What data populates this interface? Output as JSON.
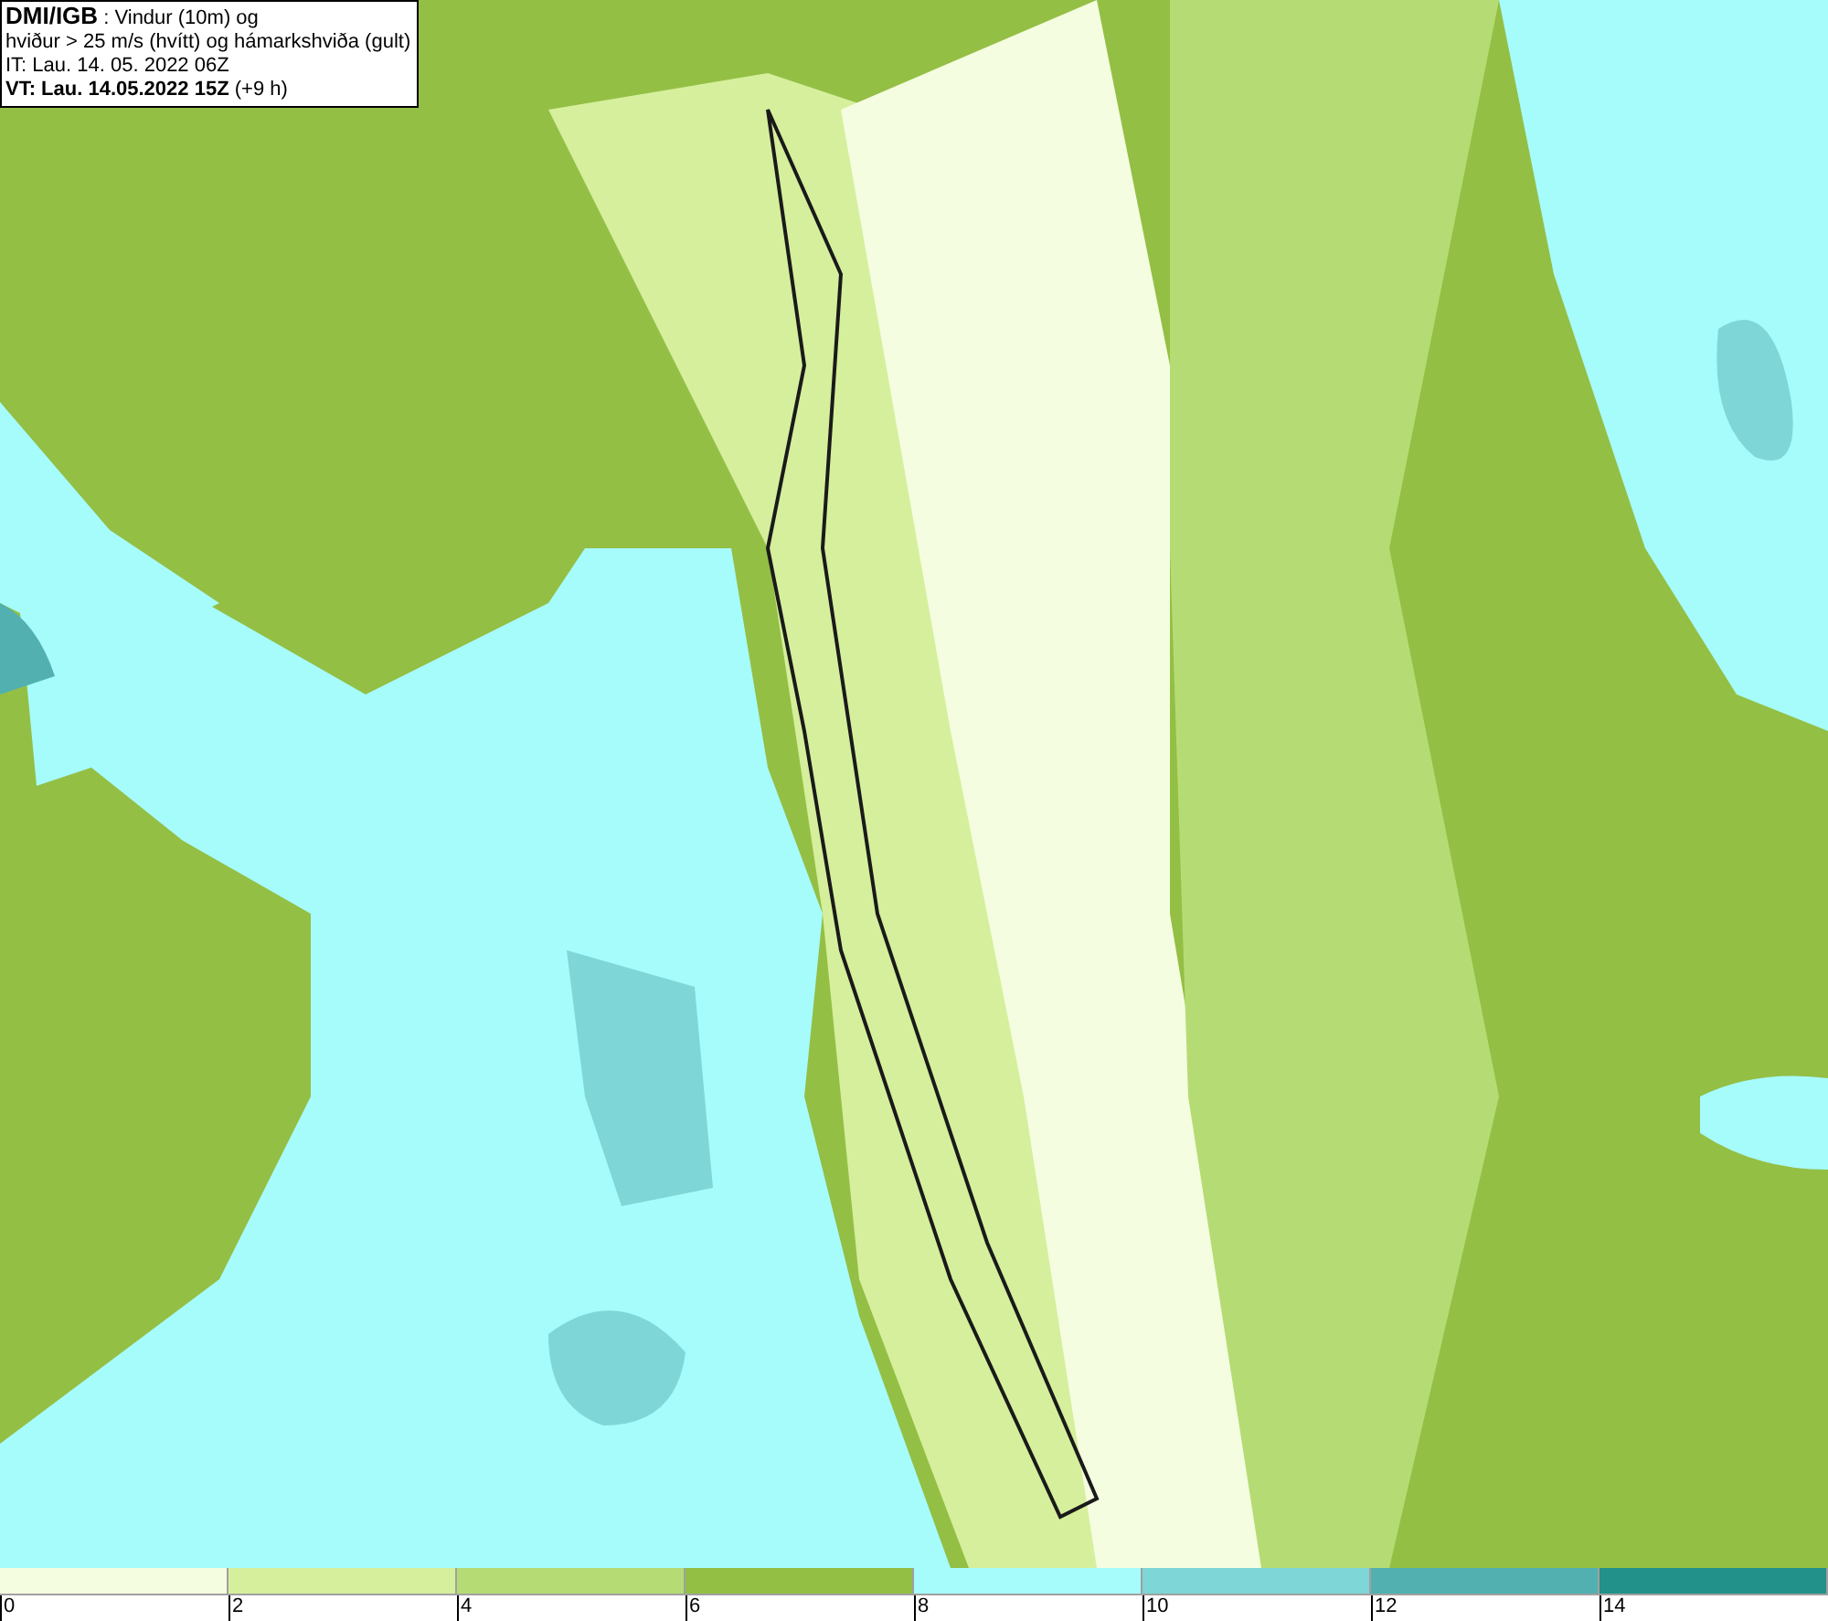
{
  "info_box": {
    "lines": [
      "**DMI/IGB** : Vindur (10m) og",
      "hviður > 25 m/s (hvítt) og hámarkshviða (gult)",
      "IT: Lau. 14. 05. 2022 06Z",
      "**VT: Lau. 14.05.2022 15Z** (+9 h)"
    ]
  },
  "legend": {
    "segments": [
      {
        "color": "#f4fde0"
      },
      {
        "color": "#d5ef9c"
      },
      {
        "color": "#b5dc74"
      },
      {
        "color": "#94bf45"
      },
      {
        "color": "#a6fbfb"
      },
      {
        "color": "#7fd6d6"
      },
      {
        "color": "#52b0b0"
      },
      {
        "color": "#21918a"
      }
    ],
    "ticks": [
      "0",
      "2",
      "4",
      "6",
      "8",
      "10",
      "12",
      "14"
    ]
  }
}
